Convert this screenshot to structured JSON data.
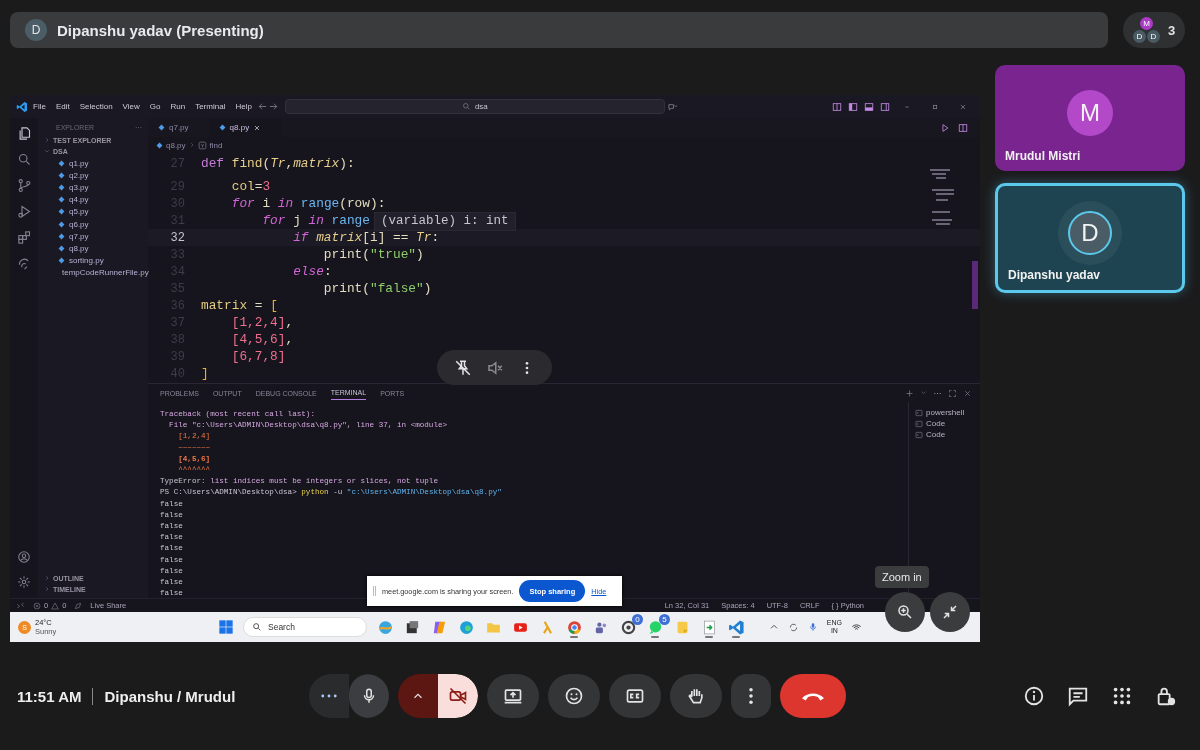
{
  "presenter_bar": {
    "avatar": "D",
    "title": "Dipanshu yadav (Presenting)"
  },
  "participants": {
    "avatars": [
      {
        "initial": "M",
        "color": "#a93bc4"
      },
      {
        "initial": "D",
        "color": "#4a5a63"
      },
      {
        "initial": "D",
        "color": "#4a5a63"
      }
    ],
    "count": "3"
  },
  "screen": {
    "menu": [
      "File",
      "Edit",
      "Selection",
      "View",
      "Go",
      "Run",
      "Terminal",
      "Help"
    ],
    "search": "dsa",
    "explorer": {
      "title": "EXPLORER",
      "more": "···",
      "sections": [
        {
          "label": "TEST EXPLORER",
          "expanded": false
        },
        {
          "label": "DSA",
          "expanded": true,
          "children": [
            "q1.py",
            "q2.py",
            "q3.py",
            "q4.py",
            "q5.py",
            "q6.py",
            "q7.py",
            "q8.py",
            "sorting.py",
            "tempCodeRunnerFile.py"
          ]
        }
      ],
      "bottom_sections": [
        {
          "label": "OUTLINE",
          "expanded": false
        },
        {
          "label": "TIMELINE",
          "expanded": false
        }
      ]
    },
    "tabs": [
      {
        "label": "q7.py",
        "selected": false
      },
      {
        "label": "q8.py",
        "selected": true
      }
    ],
    "breadcrumb": [
      "q8.py",
      "find"
    ],
    "code_lines": [
      {
        "number": "27",
        "current": false,
        "tokens": [
          {
            "t": "def ",
            "kind": "keyword"
          },
          {
            "t": "find",
            "kind": "function"
          },
          {
            "t": "(",
            "kind": "plain"
          },
          {
            "t": "Tr",
            "kind": "param"
          },
          {
            "t": ",",
            "kind": "plain"
          },
          {
            "t": "matrix",
            "kind": "param"
          },
          {
            "t": "):",
            "kind": "plain"
          }
        ]
      },
      {
        "number": "29",
        "current": false,
        "tokens": [
          {
            "t": "    col",
            "kind": "variable"
          },
          {
            "t": "=",
            "kind": "plain"
          },
          {
            "t": "3",
            "kind": "number"
          }
        ]
      },
      {
        "number": "30",
        "current": false,
        "tokens": [
          {
            "t": "    for",
            "kind": "control"
          },
          {
            "t": " i ",
            "kind": "plain"
          },
          {
            "t": "in",
            "kind": "control"
          },
          {
            "t": " range",
            "kind": "builtin"
          },
          {
            "t": "(row):",
            "kind": "plain"
          }
        ]
      },
      {
        "number": "31",
        "current": false,
        "tokens": [
          {
            "t": "        for",
            "kind": "control"
          },
          {
            "t": " j ",
            "kind": "plain"
          },
          {
            "t": "in",
            "kind": "control"
          },
          {
            "t": " range",
            "kind": "builtin"
          }
        ]
      },
      {
        "number": "32",
        "current": true,
        "tokens": [
          {
            "t": "            if",
            "kind": "control"
          },
          {
            "t": " matrix",
            "kind": "param"
          },
          {
            "t": "[i] == ",
            "kind": "plain"
          },
          {
            "t": "Tr",
            "kind": "param"
          },
          {
            "t": ":",
            "kind": "plain"
          }
        ]
      },
      {
        "number": "33",
        "current": false,
        "tokens": [
          {
            "t": "                print(",
            "kind": "plain"
          },
          {
            "t": "\"true\"",
            "kind": "string"
          },
          {
            "t": ")",
            "kind": "plain"
          }
        ]
      },
      {
        "number": "34",
        "current": false,
        "tokens": [
          {
            "t": "            else",
            "kind": "control"
          },
          {
            "t": ":",
            "kind": "plain"
          }
        ]
      },
      {
        "number": "35",
        "current": false,
        "tokens": [
          {
            "t": "                print(",
            "kind": "plain"
          },
          {
            "t": "\"false\"",
            "kind": "string"
          },
          {
            "t": ")",
            "kind": "plain"
          }
        ]
      },
      {
        "number": "36",
        "current": false,
        "tokens": [
          {
            "t": "matrix",
            "kind": "variable"
          },
          {
            "t": " = ",
            "kind": "plain"
          },
          {
            "t": "[",
            "kind": "bracket"
          }
        ]
      },
      {
        "number": "37",
        "current": false,
        "tokens": [
          {
            "t": "    [1,2,4]",
            "kind": "number"
          },
          {
            "t": ",",
            "kind": "plain"
          }
        ]
      },
      {
        "number": "38",
        "current": false,
        "tokens": [
          {
            "t": "    [4,5,6]",
            "kind": "number"
          },
          {
            "t": ",",
            "kind": "plain"
          }
        ]
      },
      {
        "number": "39",
        "current": false,
        "tokens": [
          {
            "t": "    [6,7,8]",
            "kind": "number"
          }
        ]
      },
      {
        "number": "40",
        "current": false,
        "tokens": [
          {
            "t": "]",
            "kind": "bracket"
          }
        ]
      }
    ],
    "hover": "(variable) i: int",
    "panel_tabs": [
      {
        "label": "PROBLEMS",
        "selected": false
      },
      {
        "label": "OUTPUT",
        "selected": false
      },
      {
        "label": "DEBUG CONSOLE",
        "selected": false
      },
      {
        "label": "TERMINAL",
        "selected": true
      },
      {
        "label": "PORTS",
        "selected": false
      }
    ],
    "terminal_lines": [
      [
        {
          "t": "Traceback (most recent call last):",
          "kind": "trace"
        }
      ],
      [
        {
          "t": "  File \"c:\\Users\\ADMIN\\Desktop\\dsa\\q8.py\", line 37, in <module>",
          "kind": "trace"
        }
      ],
      [
        {
          "t": "    [1,2,4]",
          "kind": "errcode"
        }
      ],
      [
        {
          "t": "    ~~~~~~~",
          "kind": "errcode"
        }
      ],
      [
        {
          "t": "    [4,5,6]",
          "kind": "errbold"
        }
      ],
      [
        {
          "t": "    ^^^^^^^",
          "kind": "errcode"
        }
      ],
      [
        {
          "t": "TypeError",
          "kind": "errname"
        },
        {
          "t": ": list indices must be integers or slices, not tuple",
          "kind": "trace"
        }
      ],
      [
        {
          "t": "PS C:\\Users\\ADMIN\\Desktop\\dsa> ",
          "kind": "plain"
        },
        {
          "t": "python",
          "kind": "command"
        },
        {
          "t": " -u ",
          "kind": "plain"
        },
        {
          "t": "\"c:\\Users\\ADMIN\\Desktop\\dsa\\q8.py\"",
          "kind": "arg"
        }
      ],
      [
        {
          "t": "false",
          "kind": "plain"
        }
      ],
      [
        {
          "t": "false",
          "kind": "plain"
        }
      ],
      [
        {
          "t": "false",
          "kind": "plain"
        }
      ],
      [
        {
          "t": "false",
          "kind": "plain"
        }
      ],
      [
        {
          "t": "false",
          "kind": "plain"
        }
      ],
      [
        {
          "t": "false",
          "kind": "plain"
        }
      ],
      [
        {
          "t": "false",
          "kind": "plain"
        }
      ],
      [
        {
          "t": "false",
          "kind": "plain"
        }
      ],
      [
        {
          "t": "false",
          "kind": "plain"
        }
      ]
    ],
    "terminals": [
      "powershell",
      "Code",
      "Code"
    ],
    "status_bar": {
      "errors": "0",
      "warnings": "0",
      "live_share": "Live Share",
      "items": [
        "Ln 32, Col 31",
        "Spaces: 4",
        "UTF-8",
        "CRLF",
        "{ } Python"
      ]
    },
    "taskbar": {
      "weather": {
        "badge": "S",
        "temperature": "24°C",
        "condition": "Sunny"
      },
      "search": "Search",
      "apps": [
        {
          "kind": "widgets"
        },
        {
          "kind": "terminal"
        },
        {
          "kind": "copilot"
        },
        {
          "kind": "edge"
        },
        {
          "kind": "folder"
        },
        {
          "kind": "youtube"
        },
        {
          "kind": "generic"
        },
        {
          "kind": "chrome"
        },
        {
          "kind": "teams"
        },
        {
          "kind": "chatgpt",
          "badge": "0"
        },
        {
          "kind": "whatsapp",
          "badge": "5"
        },
        {
          "kind": "notes"
        },
        {
          "kind": "runner"
        },
        {
          "kind": "vscode"
        }
      ],
      "language": "ENG",
      "region": "IN"
    }
  },
  "share_notice": {
    "text": "meet.google.com is sharing your screen.",
    "stop": "Stop sharing",
    "hide": "Hide"
  },
  "zoom_tooltip": "Zoom in",
  "tiles": [
    {
      "name": "Mrudul Mistri",
      "initial": "M",
      "color": "#7a2490",
      "highlighted": false
    },
    {
      "name": "Dipanshu yadav",
      "initial": "D",
      "color": "#1d4450",
      "highlighted": true
    }
  ],
  "footer": {
    "time": "11:51 AM",
    "meeting": "Dipanshu / Mrudul",
    "mic_on": true,
    "camera_on": false
  }
}
